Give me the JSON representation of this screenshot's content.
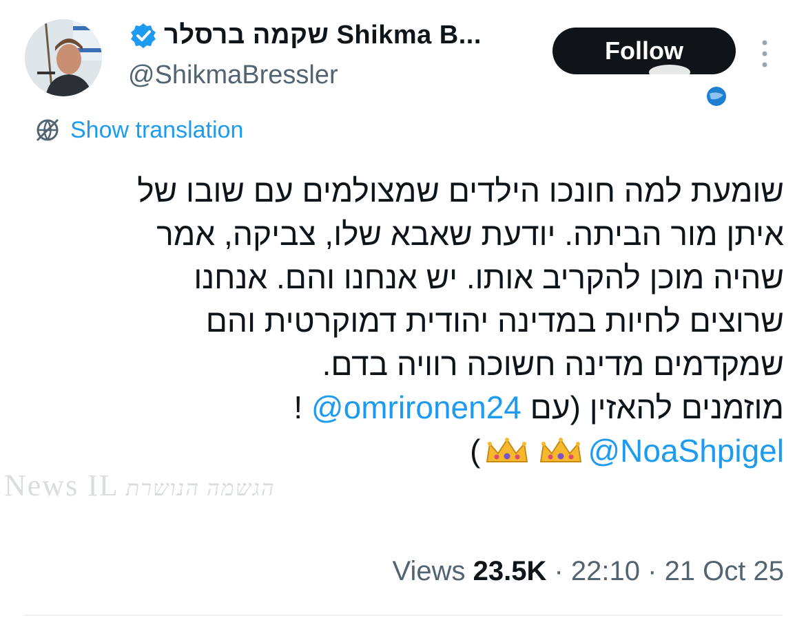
{
  "author": {
    "display_name": "שקמה ברסלר Shikma B...",
    "handle": "@ShikmaBressler",
    "verified": true
  },
  "actions": {
    "follow_label": "Follow"
  },
  "translation": {
    "label": "Show translation"
  },
  "tweet": {
    "lines": [
      "שומעת למה חונכו הילדים שמצולמים עם שובו של",
      "איתן מור הביתה.  יודעת שאבא שלו, צביקה, אמר",
      "שהיה מוכן להקריב אותו. יש אנחנו והם. אנחנו",
      "שרוצים לחיות במדינה יהודית דמוקרטית והם",
      "שמקדמים מדינה חשוכה רוויה בדם."
    ],
    "invite_text": "מוזמנים להאזין (עם ",
    "mention_1": "@omrironen24",
    "invite_end": " !",
    "mention_2": "@NoaShpigel",
    "close_paren": ")"
  },
  "watermark": {
    "text": "News IL",
    "sub": "הגשמה הנושרת"
  },
  "meta": {
    "views_label": "Views",
    "views_count": "23.5K",
    "time": "22:10",
    "date": "21 Oct 25",
    "separator": " · "
  },
  "colors": {
    "accent": "#1d9bf0",
    "text": "#0f1419",
    "muted": "#536471",
    "button_bg": "#0f1419"
  },
  "icons": [
    "verified-badge-icon",
    "translate-icon",
    "more-vertical-icon",
    "crown-emoji-icon",
    "globe-icon"
  ]
}
